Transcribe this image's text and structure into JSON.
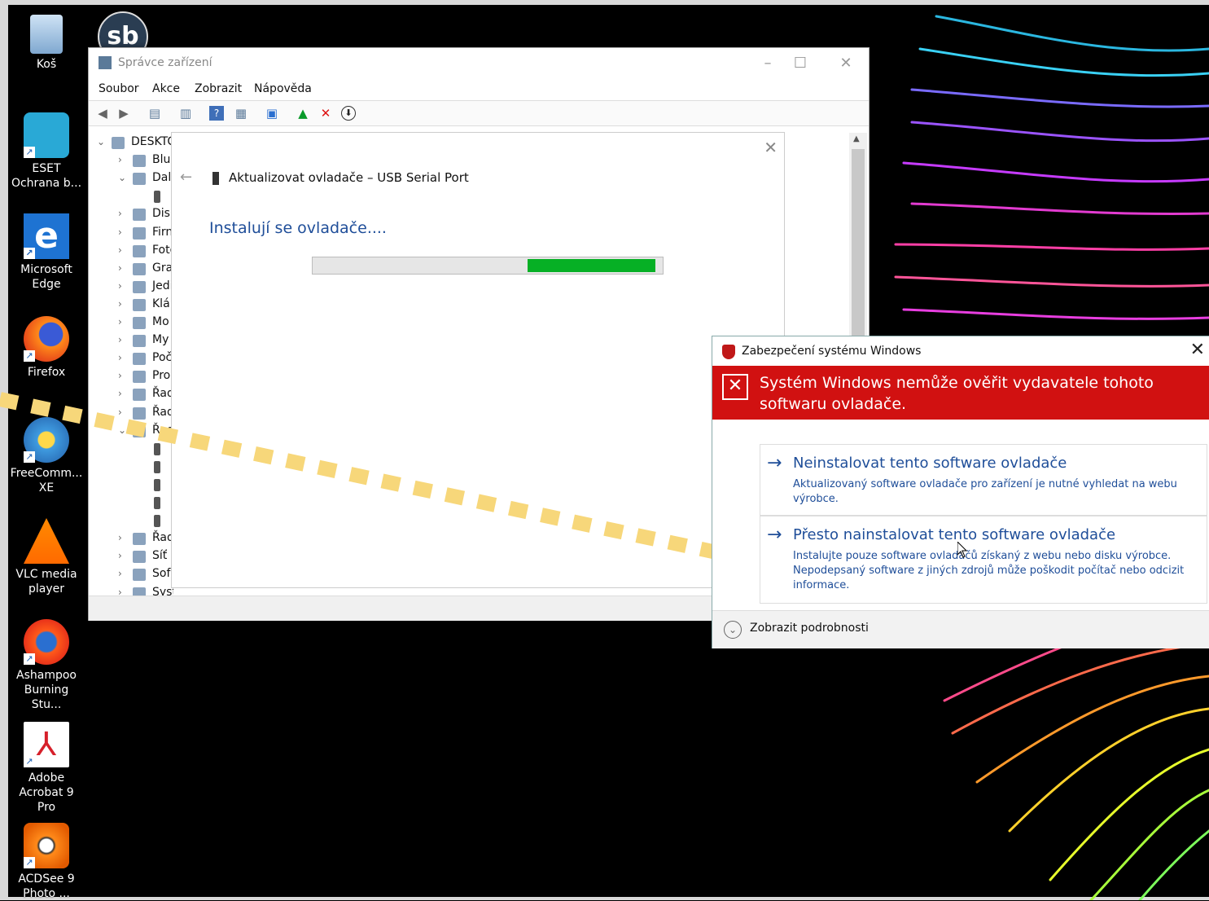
{
  "desktop": {
    "icons": [
      {
        "label": "Koš",
        "icon": "recycle-bin-icon"
      },
      {
        "label": "ESET Ochrana b...",
        "icon": "eset-icon"
      },
      {
        "label": "Microsoft Edge",
        "icon": "edge-icon"
      },
      {
        "label": "Firefox",
        "icon": "firefox-icon"
      },
      {
        "label": "FreeComm... XE",
        "icon": "freecommander-icon"
      },
      {
        "label": "VLC media player",
        "icon": "vlc-icon"
      },
      {
        "label": "Ashampoo Burning Stu...",
        "icon": "ashampoo-icon"
      },
      {
        "label": "Adobe Acrobat 9 Pro",
        "icon": "acrobat-icon"
      },
      {
        "label": "ACDSee 9 Photo ...",
        "icon": "acdsee-icon"
      }
    ],
    "logo_text": "sb"
  },
  "device_manager": {
    "title": "Správce zařízení",
    "menu": [
      "Soubor",
      "Akce",
      "Zobrazit",
      "Nápověda"
    ],
    "window_controls": [
      "–",
      "☐",
      "✕"
    ],
    "tree": [
      {
        "exp": "⌄",
        "label": "DESKTC",
        "root": true
      },
      {
        "exp": "›",
        "label": "Blu"
      },
      {
        "exp": "⌄",
        "label": "Dal"
      },
      {
        "exp": "",
        "label": ""
      },
      {
        "exp": "›",
        "label": "Disl"
      },
      {
        "exp": "›",
        "label": "Firn"
      },
      {
        "exp": "›",
        "label": "Foto"
      },
      {
        "exp": "›",
        "label": "Gra"
      },
      {
        "exp": "›",
        "label": "Jedi"
      },
      {
        "exp": "›",
        "label": "Klá"
      },
      {
        "exp": "›",
        "label": "Mo"
      },
      {
        "exp": "›",
        "label": "My"
      },
      {
        "exp": "›",
        "label": "Poč"
      },
      {
        "exp": "›",
        "label": "Pro"
      },
      {
        "exp": "›",
        "label": "Řad"
      },
      {
        "exp": "›",
        "label": "Řad"
      },
      {
        "exp": "⌄",
        "label": "Řad"
      },
      {
        "exp": "",
        "label": ""
      },
      {
        "exp": "",
        "label": ""
      },
      {
        "exp": "",
        "label": ""
      },
      {
        "exp": "",
        "label": ""
      },
      {
        "exp": "",
        "label": ""
      },
      {
        "exp": "›",
        "label": "Řad"
      },
      {
        "exp": "›",
        "label": "Síť"
      },
      {
        "exp": "›",
        "label": "Sof"
      },
      {
        "exp": "›",
        "label": "Systémová zařízení"
      }
    ]
  },
  "update_driver": {
    "back_glyph": "←",
    "close_glyph": "✕",
    "header": "Aktualizovat ovladače – USB Serial Port",
    "status": "Instalují se ovladače....",
    "progress": {
      "segment_start": 0.615,
      "segment_end": 0.98,
      "color": "#06b025"
    }
  },
  "security_dialog": {
    "title": "Zabezpečení systému Windows",
    "close_glyph": "✕",
    "warning": "Systém Windows nemůže ověřit vydavatele tohoto softwaru ovladače.",
    "warning_color": "#d11111",
    "options": [
      {
        "arrow": "→",
        "title": "Neinstalovat tento software ovladače",
        "desc": "Aktualizovaný software ovladače pro zařízení je nutné vyhledat na webu výrobce."
      },
      {
        "arrow": "→",
        "title": "Přesto nainstalovat tento software ovladače",
        "desc": "Instalujte pouze software ovladačů získaný z webu nebo disku výrobce. Nepodepsaný software z jiných zdrojů může poškodit počítač nebo odcizit informace."
      }
    ],
    "details_label": "Zobrazit podrobnosti",
    "details_glyph": "⌄"
  },
  "annotation": {
    "color": "#f7d77a"
  }
}
